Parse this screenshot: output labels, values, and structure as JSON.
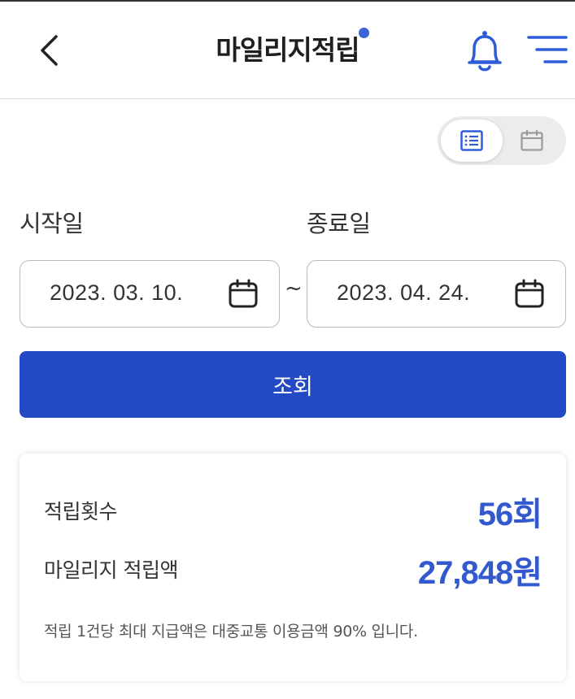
{
  "header": {
    "title": "마일리지적립",
    "back_icon": "chevron-left-icon",
    "bell_icon": "bell-icon",
    "menu_icon": "menu-icon"
  },
  "view_toggle": {
    "options": [
      "list-icon",
      "calendar-icon"
    ],
    "selected": "list-icon"
  },
  "period": {
    "start_label": "시작일",
    "end_label": "종료일",
    "start_date": "2023. 03. 10.",
    "end_date": "2023. 04. 24.",
    "separator": "~"
  },
  "search_button": {
    "label": "조회"
  },
  "summary": {
    "count_label": "적립횟수",
    "count_value": "56회",
    "amount_label": "마일리지 적립액",
    "amount_value": "27,848원",
    "note": "적립 1건당 최대 지급액은 대중교통 이용금액 90% 입니다."
  },
  "colors": {
    "accent": "#2449c4",
    "value_text": "#3359cf",
    "notification_dot": "#3a63d8"
  }
}
